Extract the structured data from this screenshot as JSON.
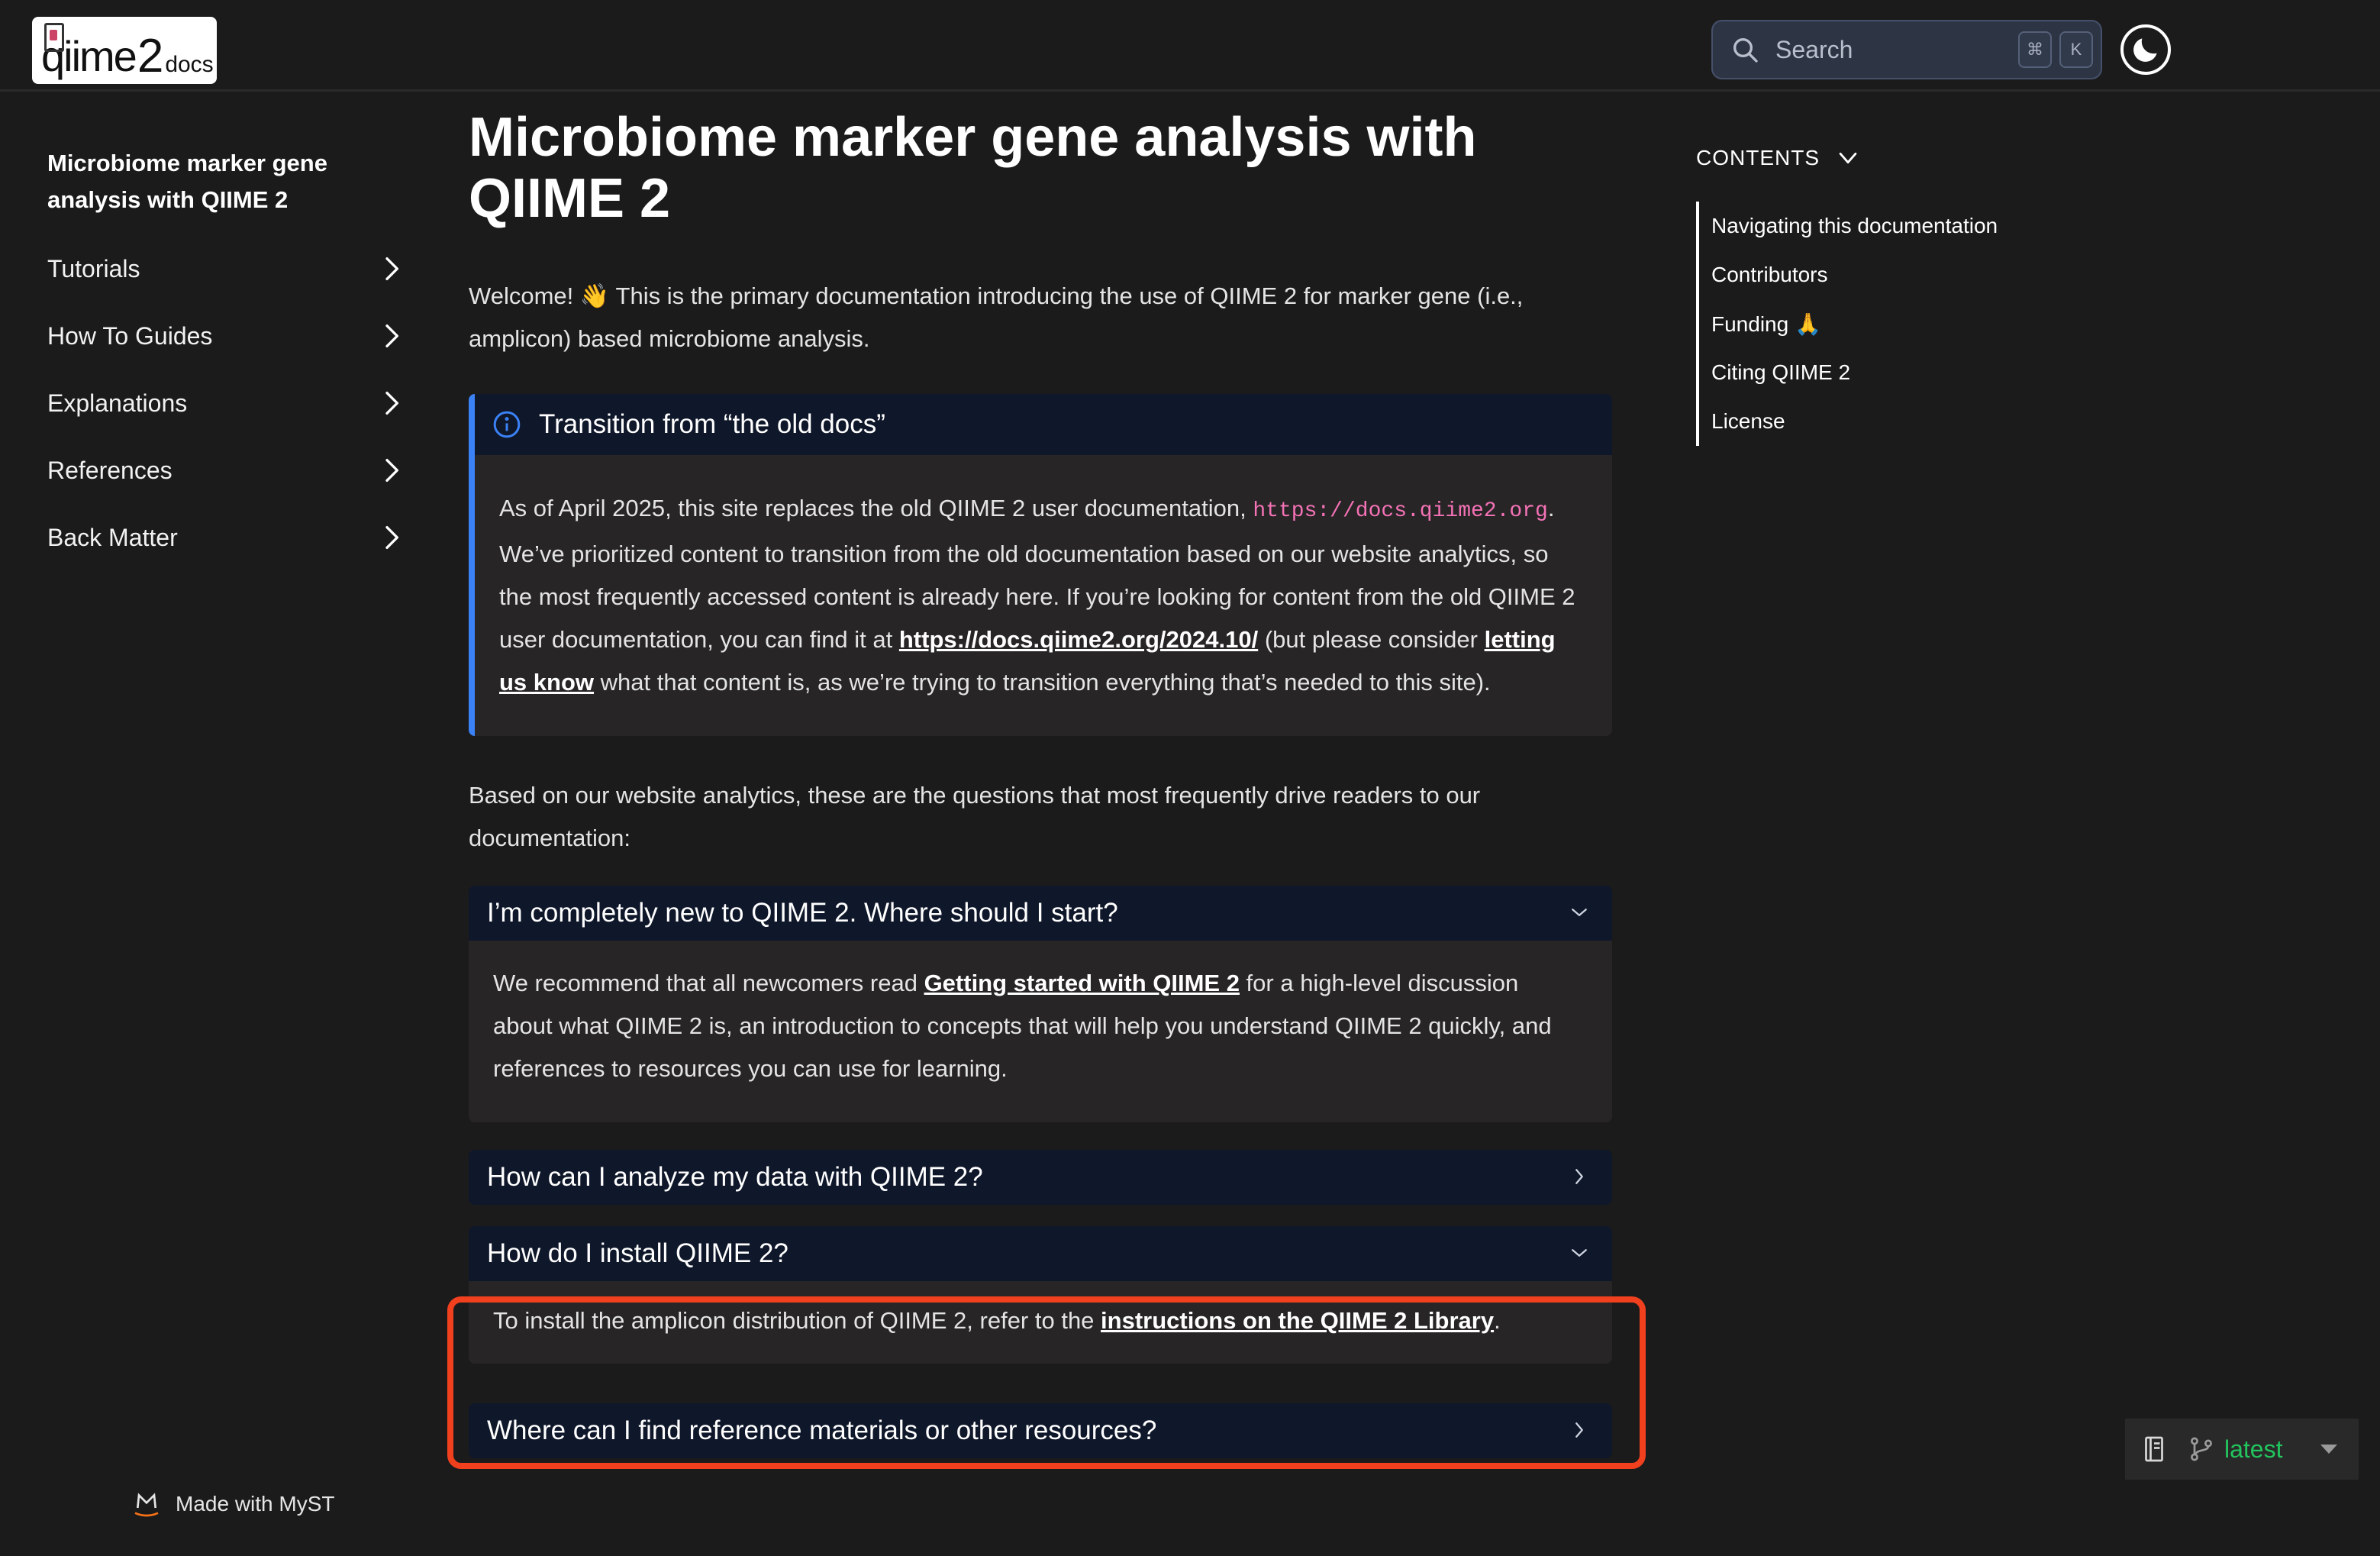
{
  "header": {
    "logo_text": "qiime2docs",
    "search": {
      "placeholder": "Search",
      "shortcut_keys": [
        "⌘",
        "K"
      ]
    },
    "theme_toggle_icon": "moon-icon"
  },
  "sidebar": {
    "title": "Microbiome marker gene analysis with QIIME 2",
    "items": [
      {
        "label": "Tutorials"
      },
      {
        "label": "How To Guides"
      },
      {
        "label": "Explanations"
      },
      {
        "label": "References"
      },
      {
        "label": "Back Matter"
      }
    ],
    "footer": "Made with MyST"
  },
  "main": {
    "title": "Microbiome marker gene analysis with QIIME 2",
    "intro": {
      "before_emoji": "Welcome!",
      "emoji": "👋",
      "after_emoji": " This is the primary documentation introducing the use of QIIME 2 for marker gene (i.e., amplicon) based microbiome analysis."
    },
    "admonition": {
      "title": "Transition from “the old docs”",
      "text_1": "As of April 2025, this site replaces the old QIIME 2 user documentation, ",
      "code": "https://docs.qiime2.org",
      "text_2": ". We’ve prioritized content to transition from the old documentation based on our website analytics, so the most frequently accessed content is already here. If you’re looking for content from the old QIIME 2 user documentation, you can find it at ",
      "link_1": "https://docs.qiime2.org/2024.10/",
      "text_3": " (but please consider ",
      "link_2": "letting us know",
      "text_4": " what that content is, as we’re trying to transition everything that’s needed to this site)."
    },
    "questions_intro": "Based on our website analytics, these are the questions that most frequently drive readers to our documentation:",
    "dropdowns": [
      {
        "title": "I’m completely new to QIIME 2. Where should I start?",
        "expanded": true,
        "text_1": "We recommend that all newcomers read ",
        "link": "Getting started with QIIME 2",
        "text_2": " for a high-level discussion about what QIIME 2 is, an introduction to concepts that will help you understand QIIME 2 quickly, and references to resources you can use for learning."
      },
      {
        "title": "How can I analyze my data with QIIME 2?",
        "expanded": false
      },
      {
        "title": "How do I install QIIME 2?",
        "expanded": true,
        "text_1": "To install the amplicon distribution of QIIME 2, refer to the ",
        "link": "instructions on the QIIME 2 Library",
        "text_2": "."
      },
      {
        "title": "Where can I find reference materials or other resources?",
        "expanded": false
      }
    ]
  },
  "toc": {
    "heading": "CONTENTS",
    "items": [
      {
        "label": "Navigating this documentation"
      },
      {
        "label": "Contributors"
      },
      {
        "label": "Funding 🙏"
      },
      {
        "label": "Citing QIIME 2"
      },
      {
        "label": "License"
      }
    ]
  },
  "version": {
    "label": "latest"
  },
  "colors": {
    "background": "#1c1b1b",
    "panel_header": "#0f172a",
    "panel_body": "#272525",
    "admonition_accent": "#3b82f6",
    "code_text": "#f472b6",
    "version_text": "#22c55e",
    "highlight_border": "#f0401e"
  }
}
